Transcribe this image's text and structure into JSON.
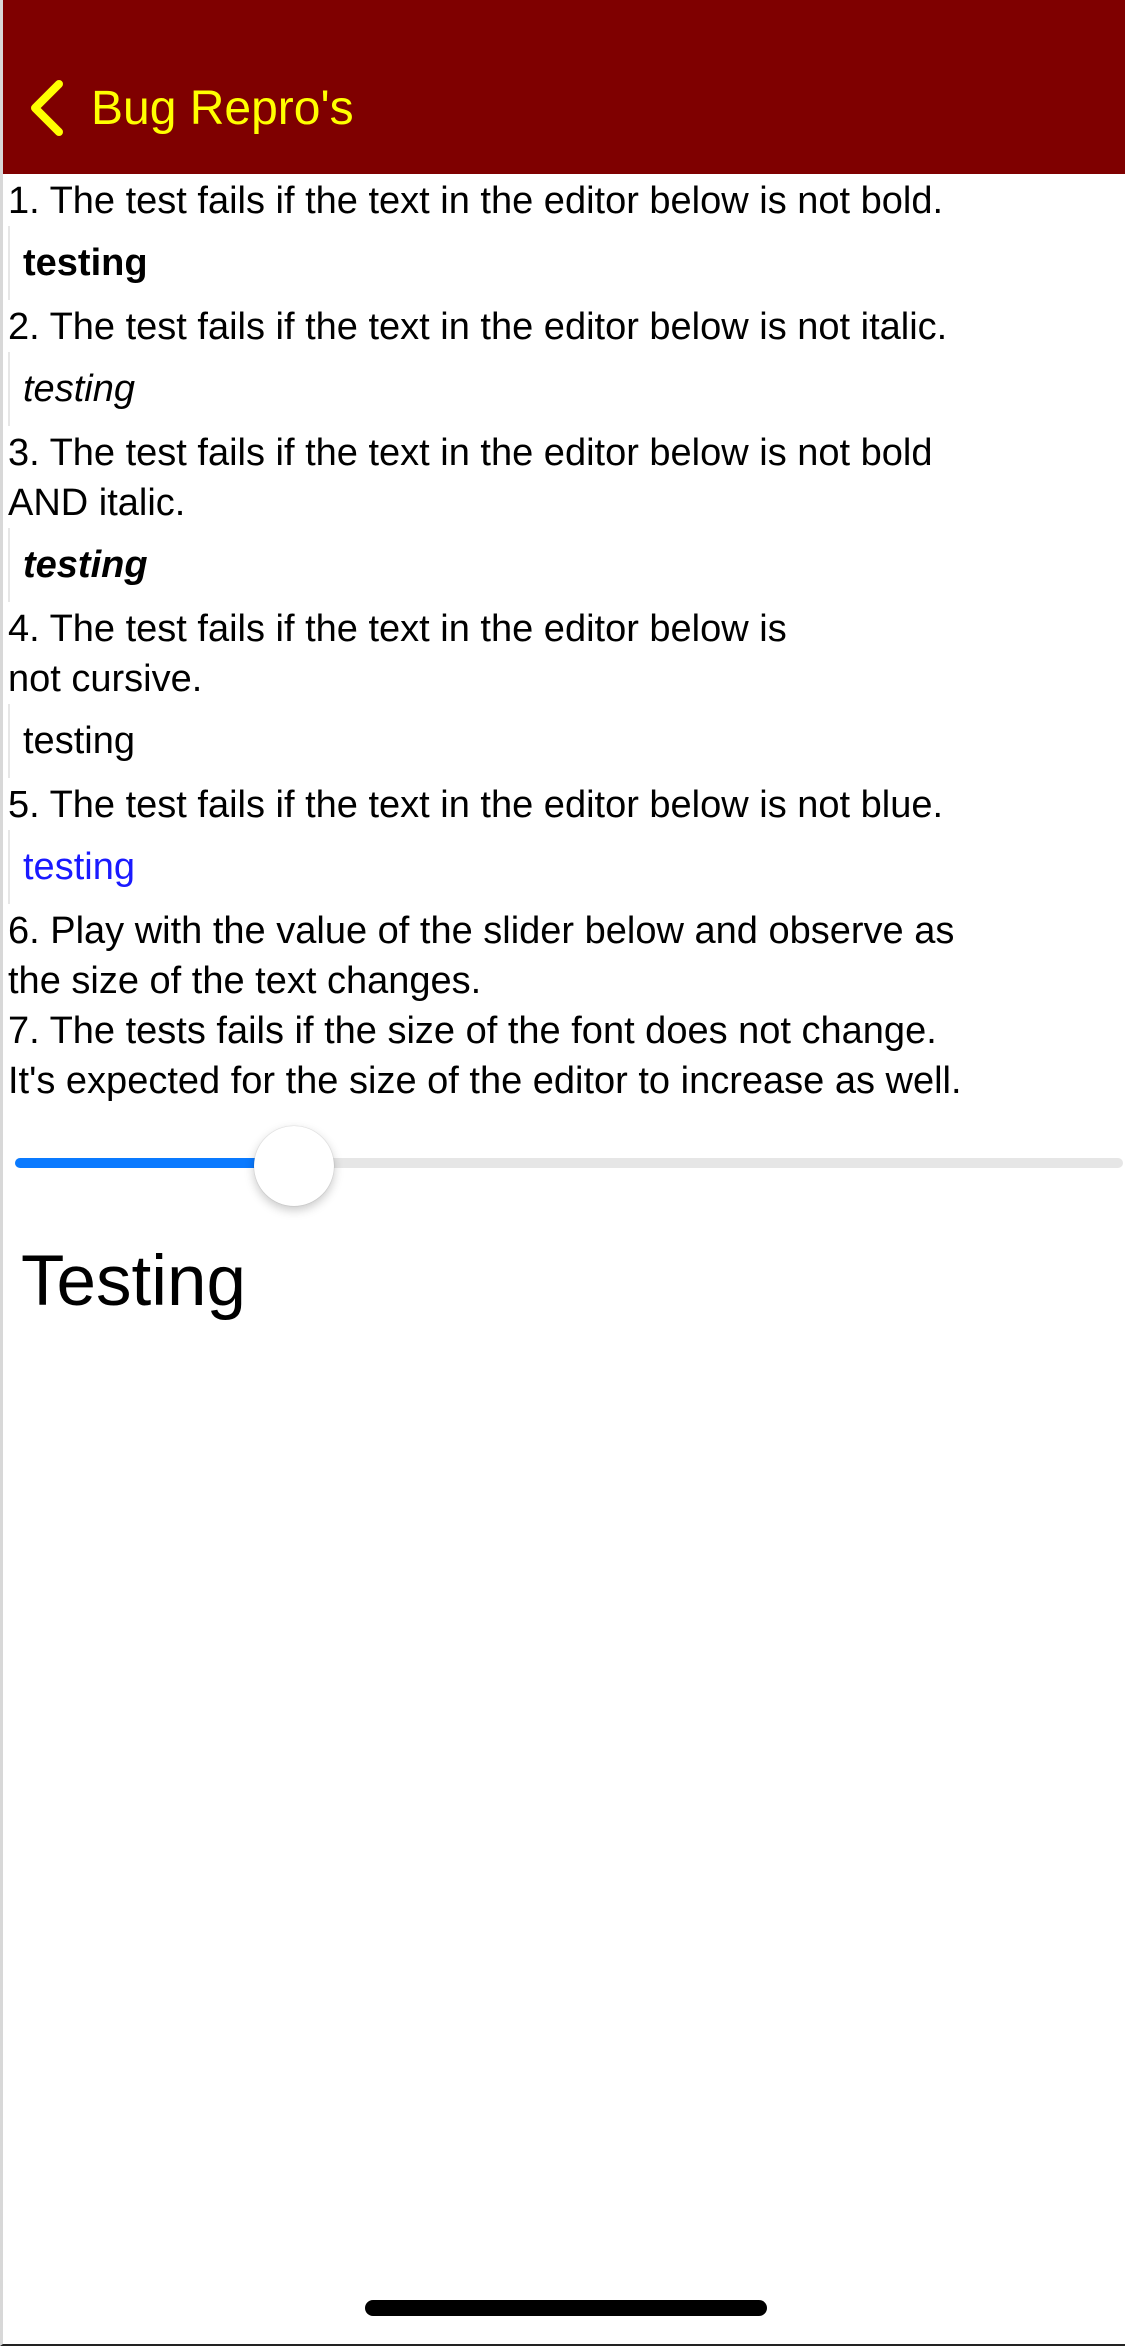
{
  "nav": {
    "back_label": "Bug Repro's",
    "color": "#7f0000",
    "tint": "#ffff00"
  },
  "tests": [
    {
      "instruction": "1. The test fails if the text in the editor below is not bold.",
      "editor_text": "testing"
    },
    {
      "instruction": "2. The test fails if the text in the editor below is not italic.",
      "editor_text": "testing"
    },
    {
      "instruction": "3. The test fails if the text in the editor below is not bold\nAND italic.",
      "editor_text": "testing"
    },
    {
      "instruction": "4. The test fails if the text in the editor below is\nnot cursive.",
      "editor_text": "testing"
    },
    {
      "instruction": "5. The test fails if the text in the editor below is not blue.",
      "editor_text": "testing"
    }
  ],
  "slider_instructions": "6. Play with the value of the slider below and observe as\nthe size of the text changes.\n7. The tests fails if the size of the font does not change.\nIt's expected for the size of the editor to increase as well.",
  "slider": {
    "value_fraction": 0.22,
    "fill_color": "#0a7aff"
  },
  "font_size_editor_text": "Testing",
  "colors": {
    "blue_text": "#1a1aff"
  }
}
